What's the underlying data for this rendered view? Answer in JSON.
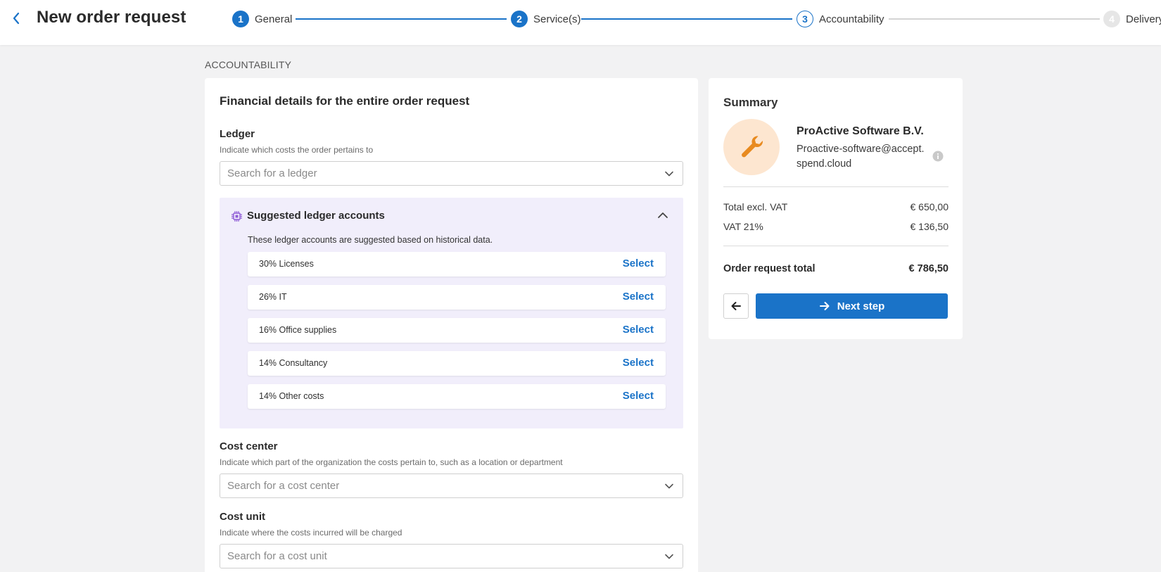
{
  "header": {
    "title": "New order request",
    "steps": [
      {
        "number": "1",
        "label": "General",
        "state": "done"
      },
      {
        "number": "2",
        "label": "Service(s)",
        "state": "done"
      },
      {
        "number": "3",
        "label": "Accountability",
        "state": "current"
      },
      {
        "number": "4",
        "label": "Delivery",
        "state": "todo"
      }
    ]
  },
  "section_heading": "ACCOUNTABILITY",
  "financial": {
    "title": "Financial details for the entire order request",
    "ledger": {
      "label": "Ledger",
      "hint": "Indicate which costs the order pertains to",
      "placeholder": "Search for a ledger"
    },
    "suggestions": {
      "title": "Suggested ledger accounts",
      "description": "These ledger accounts are suggested based on historical data.",
      "select_label": "Select",
      "items": [
        {
          "label": "30% Licenses"
        },
        {
          "label": "26% IT"
        },
        {
          "label": "16% Office supplies"
        },
        {
          "label": "14% Consultancy"
        },
        {
          "label": "14% Other costs"
        }
      ]
    },
    "cost_center": {
      "label": "Cost center",
      "hint": "Indicate which part of the organization the costs pertain to, such as a location or department",
      "placeholder": "Search for a cost center"
    },
    "cost_unit": {
      "label": "Cost unit",
      "hint": "Indicate where the costs incurred will be charged",
      "placeholder": "Search for a cost unit"
    }
  },
  "summary": {
    "title": "Summary",
    "supplier_name": "ProActive Software B.V.",
    "supplier_email": "Proactive-software@accept.spend.cloud",
    "rows": [
      {
        "label": "Total excl. VAT",
        "value": "€ 650,00"
      },
      {
        "label": "VAT 21%",
        "value": "€ 136,50"
      }
    ],
    "total_label": "Order request total",
    "total_value": "€ 786,50",
    "next_label": "Next step"
  },
  "colors": {
    "accent": "#1a73c8",
    "suggestion_bg": "#f1eefb",
    "avatar_bg": "#fde6d0",
    "avatar_icon": "#e88a1f"
  },
  "icons": [
    "chevron-left-icon",
    "chevron-down-icon",
    "chevron-up-icon",
    "chip-icon",
    "wrench-icon",
    "info-icon",
    "arrow-left-icon",
    "arrow-right-icon"
  ]
}
